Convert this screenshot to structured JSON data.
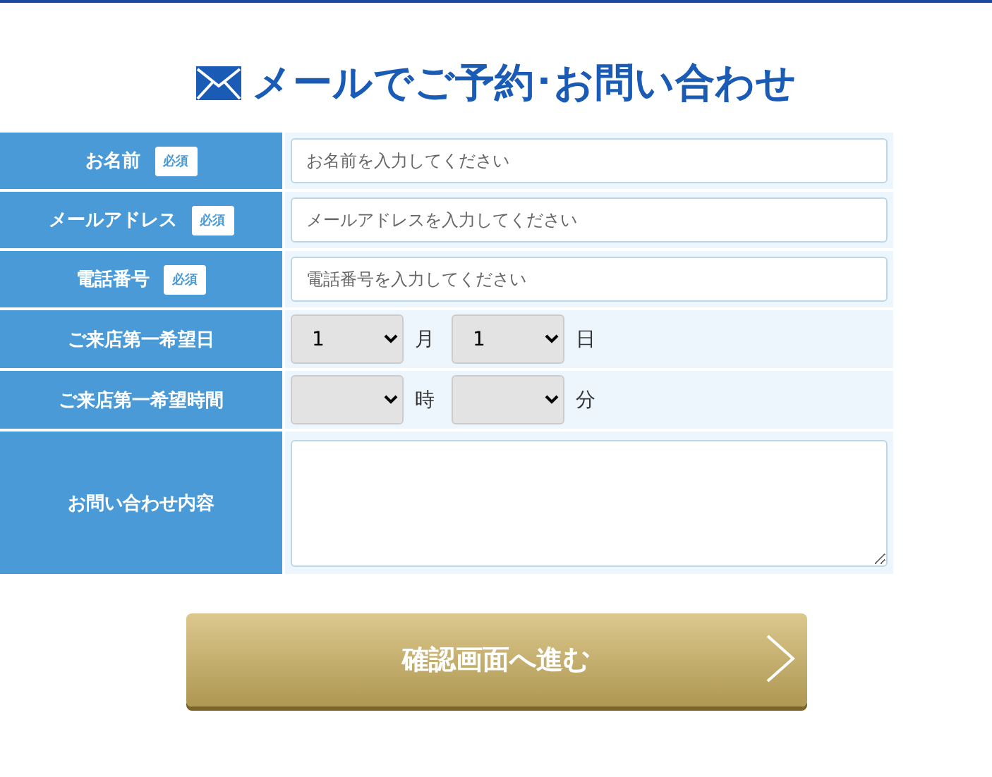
{
  "title": "メールでご予約･お問い合わせ",
  "rows": [
    {
      "kind": "text",
      "label": "お名前",
      "badge": "必須",
      "placeholder": "お名前を入力してください"
    },
    {
      "kind": "text",
      "label": "メールアドレス",
      "badge": "必須",
      "placeholder": "メールアドレスを入力してください"
    },
    {
      "kind": "text",
      "label": "電話番号",
      "badge": "必須",
      "placeholder": "電話番号を入力してください"
    },
    {
      "kind": "selects",
      "label": "ご来店第一希望日",
      "selects": [
        {
          "value": "1",
          "unit": "月"
        },
        {
          "value": "1",
          "unit": "日"
        }
      ]
    },
    {
      "kind": "selects",
      "label": "ご来店第一希望時間",
      "selects": [
        {
          "unit": "時"
        },
        {
          "unit": "分"
        }
      ]
    },
    {
      "kind": "textarea",
      "label": "お問い合わせ内容"
    }
  ],
  "submit": "確認画面へ進む"
}
